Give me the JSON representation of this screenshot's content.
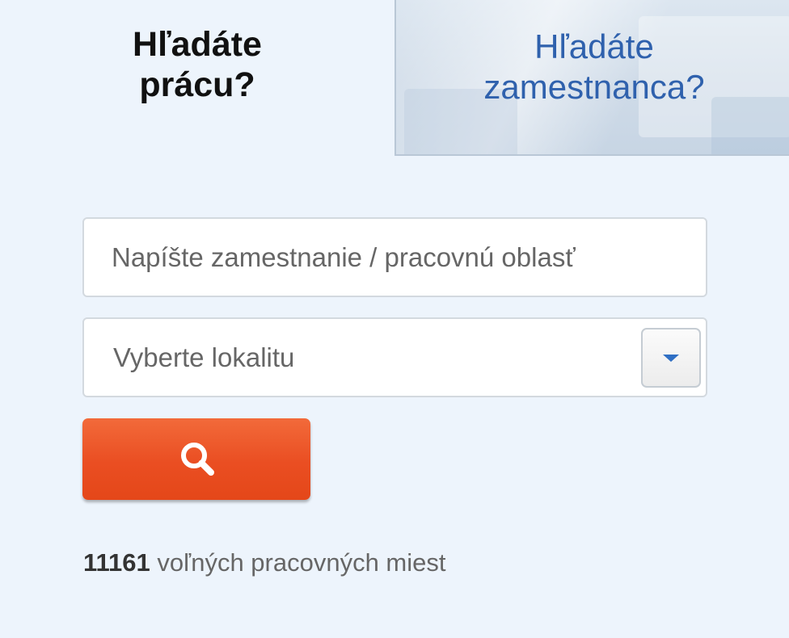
{
  "tabs": {
    "job_seeker": {
      "line1": "Hľadáte",
      "line2": "prácu?"
    },
    "employer": {
      "line1": "Hľadáte",
      "line2": "zamestnanca?"
    }
  },
  "search": {
    "job_placeholder": "Napíšte zamestnanie / pracovnú oblasť",
    "job_value": "",
    "location_placeholder": "Vyberte lokalitu",
    "location_dropdown_icon": "caret-down-icon",
    "submit_icon": "search-icon"
  },
  "stats": {
    "count": "11161",
    "label": "voľných pracovných miest"
  },
  "colors": {
    "background": "#edf4fc",
    "accent_blue": "#2f61ad",
    "search_button": "#ea4e22",
    "text_dark": "#111111",
    "text_muted": "#666666"
  }
}
